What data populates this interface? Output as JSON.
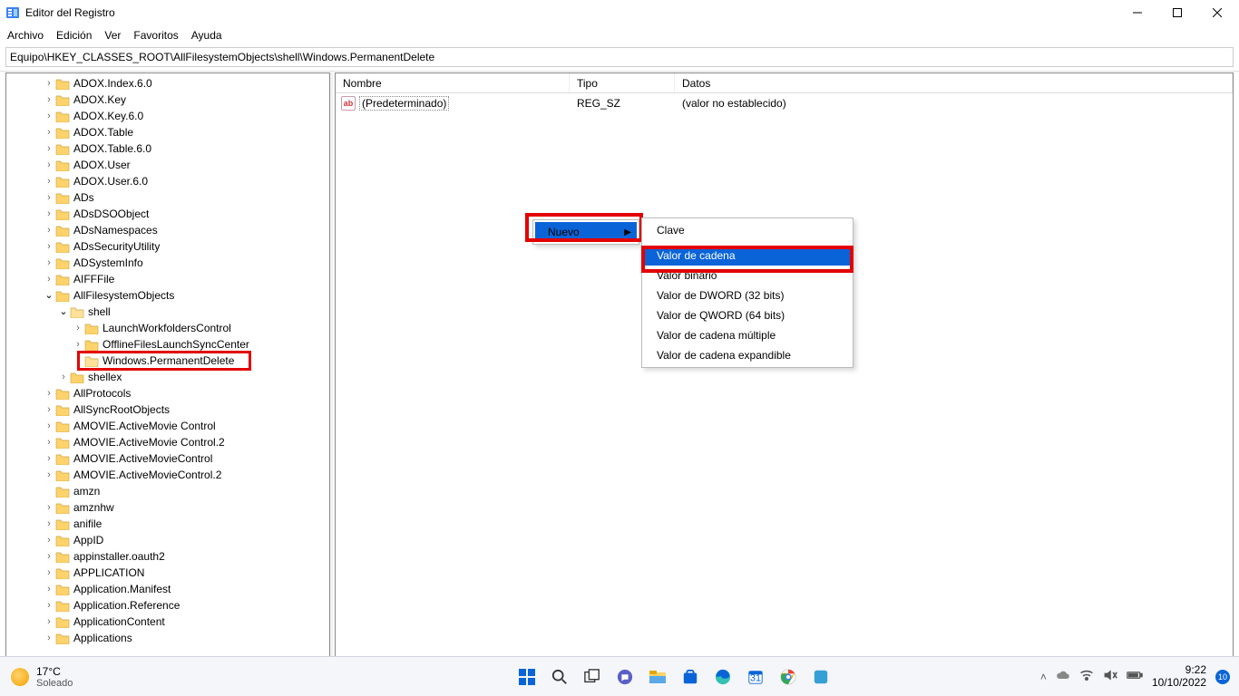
{
  "window": {
    "title": "Editor del Registro"
  },
  "menu": [
    "Archivo",
    "Edición",
    "Ver",
    "Favoritos",
    "Ayuda"
  ],
  "address": "Equipo\\HKEY_CLASSES_ROOT\\AllFilesystemObjects\\shell\\Windows.PermanentDelete",
  "tree": [
    {
      "l": 2,
      "c": ">",
      "t": "ADOX.Index.6.0"
    },
    {
      "l": 2,
      "c": ">",
      "t": "ADOX.Key"
    },
    {
      "l": 2,
      "c": ">",
      "t": "ADOX.Key.6.0"
    },
    {
      "l": 2,
      "c": ">",
      "t": "ADOX.Table"
    },
    {
      "l": 2,
      "c": ">",
      "t": "ADOX.Table.6.0"
    },
    {
      "l": 2,
      "c": ">",
      "t": "ADOX.User"
    },
    {
      "l": 2,
      "c": ">",
      "t": "ADOX.User.6.0"
    },
    {
      "l": 2,
      "c": ">",
      "t": "ADs"
    },
    {
      "l": 2,
      "c": ">",
      "t": "ADsDSOObject"
    },
    {
      "l": 2,
      "c": ">",
      "t": "ADsNamespaces"
    },
    {
      "l": 2,
      "c": ">",
      "t": "ADsSecurityUtility"
    },
    {
      "l": 2,
      "c": ">",
      "t": "ADSystemInfo"
    },
    {
      "l": 2,
      "c": ">",
      "t": "AIFFFile"
    },
    {
      "l": 2,
      "c": "v",
      "t": "AllFilesystemObjects"
    },
    {
      "l": 3,
      "c": "v",
      "t": "shell",
      "open": true
    },
    {
      "l": 4,
      "c": ">",
      "t": "LaunchWorkfoldersControl"
    },
    {
      "l": 4,
      "c": ">",
      "t": "OfflineFilesLaunchSyncCenter"
    },
    {
      "l": 4,
      "c": "",
      "t": "Windows.PermanentDelete",
      "hl": true,
      "open": true
    },
    {
      "l": 3,
      "c": ">",
      "t": "shellex"
    },
    {
      "l": 2,
      "c": ">",
      "t": "AllProtocols"
    },
    {
      "l": 2,
      "c": ">",
      "t": "AllSyncRootObjects"
    },
    {
      "l": 2,
      "c": ">",
      "t": "AMOVIE.ActiveMovie Control"
    },
    {
      "l": 2,
      "c": ">",
      "t": "AMOVIE.ActiveMovie Control.2"
    },
    {
      "l": 2,
      "c": ">",
      "t": "AMOVIE.ActiveMovieControl"
    },
    {
      "l": 2,
      "c": ">",
      "t": "AMOVIE.ActiveMovieControl.2"
    },
    {
      "l": 2,
      "c": "",
      "t": "amzn"
    },
    {
      "l": 2,
      "c": ">",
      "t": "amznhw"
    },
    {
      "l": 2,
      "c": ">",
      "t": "anifile"
    },
    {
      "l": 2,
      "c": ">",
      "t": "AppID"
    },
    {
      "l": 2,
      "c": ">",
      "t": "appinstaller.oauth2"
    },
    {
      "l": 2,
      "c": ">",
      "t": "APPLICATION"
    },
    {
      "l": 2,
      "c": ">",
      "t": "Application.Manifest"
    },
    {
      "l": 2,
      "c": ">",
      "t": "Application.Reference"
    },
    {
      "l": 2,
      "c": ">",
      "t": "ApplicationContent"
    },
    {
      "l": 2,
      "c": ">",
      "t": "Applications"
    }
  ],
  "details": {
    "headers": {
      "name": "Nombre",
      "type": "Tipo",
      "data": "Datos"
    },
    "rows": [
      {
        "name": "(Predeterminado)",
        "type": "REG_SZ",
        "data": "(valor no establecido)"
      }
    ]
  },
  "ctx_nuevo": {
    "label": "Nuevo"
  },
  "ctx_sub": [
    {
      "t": "Clave",
      "sel": false
    },
    {
      "t": "Valor de cadena",
      "sel": true
    },
    {
      "t": "Valor binario",
      "sel": false
    },
    {
      "t": "Valor de DWORD (32 bits)",
      "sel": false
    },
    {
      "t": "Valor de QWORD (64 bits)",
      "sel": false
    },
    {
      "t": "Valor de cadena múltiple",
      "sel": false
    },
    {
      "t": "Valor de cadena expandible",
      "sel": false
    }
  ],
  "taskbar": {
    "weather_temp": "17°C",
    "weather_desc": "Soleado",
    "time": "9:22",
    "date": "10/10/2022",
    "notif": "10"
  }
}
